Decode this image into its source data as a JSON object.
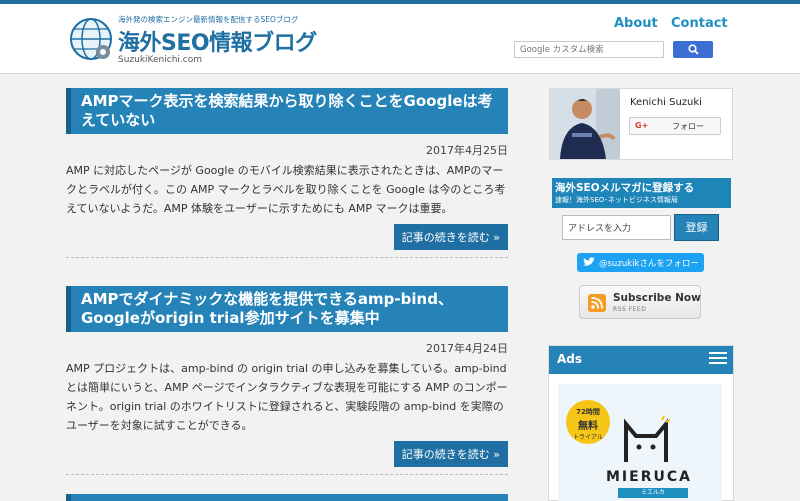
{
  "header": {
    "tagline": "海外発の検索エンジン最新情報を配信するSEOブログ",
    "site_title": "海外SEO情報ブログ",
    "domain": "SuzukiKenichi.com",
    "nav": {
      "about": "About",
      "contact": "Contact"
    },
    "search": {
      "placeholder": "Google カスタム検索"
    }
  },
  "posts": [
    {
      "title": "AMPマーク表示を検索結果から取り除くことをGoogleは考えていない",
      "date": "2017年4月25日",
      "excerpt": "AMP に対応したページが Google のモバイル検索結果に表示されたときは、AMPのマークとラベルが付く。この AMP マークとラベルを取り除くことを Google は今のところ考えていないようだ。AMP 体験をユーザーに示すためにも AMP マークは重要。",
      "read_more": "記事の続きを読む »"
    },
    {
      "title": "AMPでダイナミックな機能を提供できるamp-bind、Googleがorigin trial参加サイトを募集中",
      "date": "2017年4月24日",
      "excerpt": "AMP プロジェクトは、amp-bind の origin trial の申し込みを募集している。amp-bindとは簡単にいうと、AMP ページでインタラクティブな表現を可能にする AMP のコンポーネント。origin trial のホワイトリストに登録されると、実験段階の amp-bind を実際のユーザーを対象に試すことができる。",
      "read_more": "記事の続きを読む »"
    }
  ],
  "sidebar": {
    "profile": {
      "name": "Kenichi Suzuki",
      "gplus": "G+",
      "follow": "フォロー"
    },
    "mailmag": {
      "title": "海外SEOメルマガに登録する",
      "subtitle": "速報！海外SEO･ネットビジネス情報局",
      "input_value": "アドレスを入力",
      "submit": "登録"
    },
    "twitter": {
      "label": "@suzukikさんをフォロー"
    },
    "rss": {
      "title": "Subscribe Now",
      "subtitle": "RSS FEED"
    },
    "ads": {
      "title": "Ads",
      "badge_line1": "72時間",
      "badge_line2": "無料",
      "badge_line3": "トライアル",
      "brand": "MIERUCA",
      "brand_sub": "ミエルカ"
    }
  },
  "colors": {
    "accent": "#2583b8",
    "accent_dark": "#1a5f8a",
    "nav": "#1f8fbf",
    "twitter": "#1da1f2",
    "rss": "#f59a23"
  }
}
